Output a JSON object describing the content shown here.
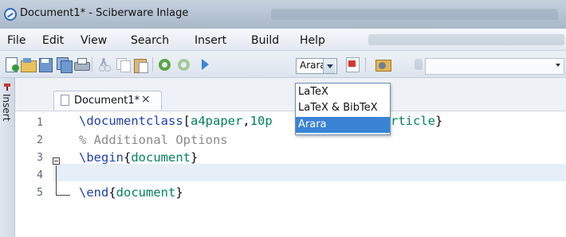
{
  "window": {
    "title": "Document1* - Sciberware Inlage"
  },
  "menu": [
    "File",
    "Edit",
    "View",
    "Search",
    "Insert",
    "Build",
    "Help"
  ],
  "toolbar": {
    "build_profile": "Arara",
    "icons": [
      "new-file-icon",
      "open-file-icon",
      "save-icon",
      "save-all-icon",
      "print-icon",
      "cut-icon",
      "copy-icon",
      "paste-icon",
      "undo-icon",
      "redo-icon",
      "run-icon",
      "build-profile-select",
      "pdf-icon",
      "settings-icon",
      "search-box"
    ]
  },
  "build_options": [
    {
      "label": "LaTeX",
      "selected": false
    },
    {
      "label": "LaTeX & BibTeX",
      "selected": false
    },
    {
      "label": "Arara",
      "selected": true
    }
  ],
  "side_panel": {
    "tab_label": "Insert"
  },
  "editor": {
    "tab_label": "Document1*",
    "tab_close": "×",
    "lines": [
      {
        "number": "1",
        "segments": [
          {
            "t": "\\documentclass",
            "c": "kw"
          },
          {
            "t": "[",
            "c": "plain"
          },
          {
            "t": "a4paper",
            "c": "arg"
          },
          {
            "t": ",",
            "c": "plain"
          },
          {
            "t": "10p",
            "c": "arg"
          }
        ],
        "tail": [
          {
            "t": "rticle",
            "c": "arg"
          },
          {
            "t": "}",
            "c": "plain"
          }
        ]
      },
      {
        "number": "2",
        "segments": [
          {
            "t": "% Additional Options",
            "c": "cm"
          }
        ]
      },
      {
        "number": "3",
        "segments": [
          {
            "t": "\\begin",
            "c": "kw"
          },
          {
            "t": "{",
            "c": "plain"
          },
          {
            "t": "document",
            "c": "arg"
          },
          {
            "t": "}",
            "c": "plain"
          }
        ]
      },
      {
        "number": "4",
        "segments": []
      },
      {
        "number": "5",
        "segments": [
          {
            "t": "\\end",
            "c": "kw"
          },
          {
            "t": "{",
            "c": "plain"
          },
          {
            "t": "document",
            "c": "arg"
          },
          {
            "t": "}",
            "c": "plain"
          }
        ]
      }
    ]
  },
  "colors": {
    "keyword": "#1f3fbf",
    "argument": "#00845c",
    "comment": "#8a8a8a",
    "selection": "#3a84d6"
  }
}
